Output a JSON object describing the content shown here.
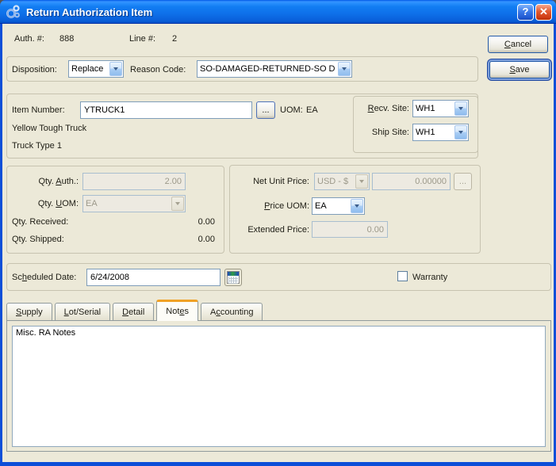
{
  "window": {
    "title": "Return Authorization Item",
    "help_glyph": "?",
    "close_glyph": "✕"
  },
  "header": {
    "auth_label": "Auth. #:",
    "auth_value": "888",
    "line_label": "Line #:",
    "line_value": "2"
  },
  "actions": {
    "cancel_label": "&Cancel",
    "save_label": "&Save"
  },
  "disposition_group": {
    "disposition_label": "Disposition:",
    "disposition_value": "Replace",
    "reason_code_label": "Reason Code:",
    "reason_code_value": "SO-DAMAGED-RETURNED-SO D"
  },
  "item_group": {
    "item_number_label": "Item Number:",
    "item_number_value": "YTRUCK1",
    "browse_label": "...",
    "uom_label": "UOM:",
    "uom_value": "EA",
    "description_line1": "Yellow Tough Truck",
    "description_line2": "Truck Type 1",
    "recv_site_label": "&Recv. Site:",
    "recv_site_value": "WH1",
    "ship_site_label": "Ship Site:",
    "ship_site_value": "WH1"
  },
  "qty_group": {
    "qty_auth_label": "Qty. &Auth.:",
    "qty_auth_value": "2.00",
    "qty_uom_label": "Qty. &UOM:",
    "qty_uom_value": "EA",
    "qty_received_label": "Qty. Received:",
    "qty_received_value": "0.00",
    "qty_shipped_label": "Qty. Shipped:",
    "qty_shipped_value": "0.00"
  },
  "price_group": {
    "net_unit_price_label": "Net Unit Price:",
    "currency_value": "USD - $",
    "net_unit_price_value": "0.00000",
    "browse_label": "...",
    "price_uom_label": "&Price UOM:",
    "price_uom_value": "EA",
    "extended_price_label": "Extended Price:",
    "extended_price_value": "0.00"
  },
  "schedule_group": {
    "scheduled_date_label": "Sc&heduled Date:",
    "scheduled_date_value": "6/24/2008",
    "warranty_label": "Warranty",
    "warranty_checked": false
  },
  "tabs": [
    {
      "label": "&Supply",
      "active": false
    },
    {
      "label": "&Lot/Serial",
      "active": false
    },
    {
      "label": "&Detail",
      "active": false
    },
    {
      "label": "Not&es",
      "active": true
    },
    {
      "label": "A&ccounting",
      "active": false
    }
  ],
  "notes_tab": {
    "text": "Misc. RA Notes"
  },
  "colors": {
    "titlebar_blue": "#0F62D8",
    "dialog_bg": "#ECE9D8",
    "active_tab_accent": "#F0A125",
    "close_red": "#D8482A",
    "field_border": "#7F9DB9"
  }
}
